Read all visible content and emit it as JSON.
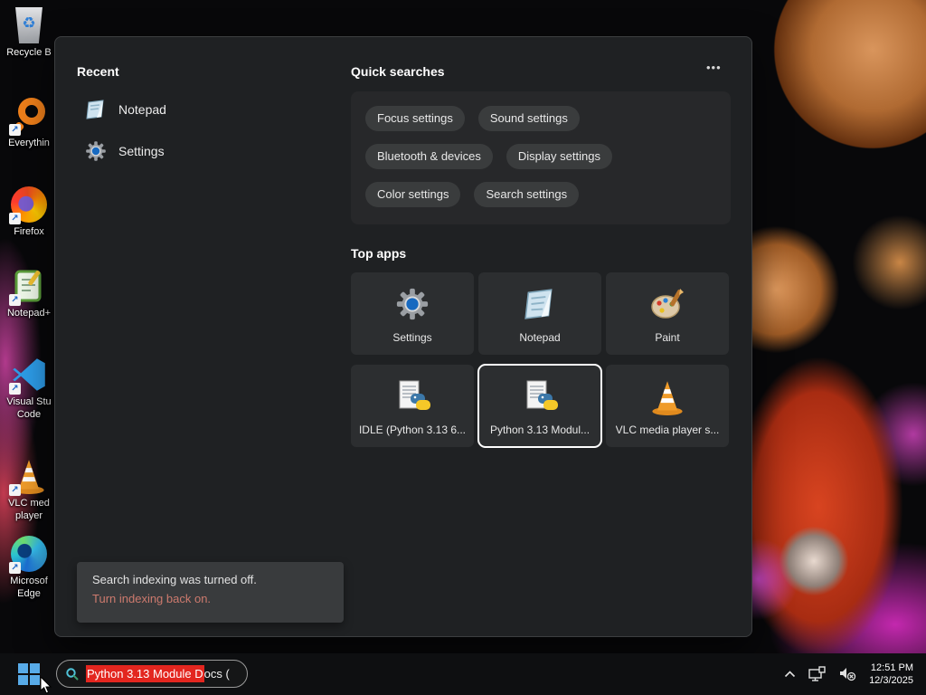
{
  "desktop": {
    "icons": [
      {
        "label": "Recycle B"
      },
      {
        "label": "Everythin"
      },
      {
        "label": "Firefox"
      },
      {
        "label": "Notepad+"
      },
      {
        "label": "Visual Stu\nCode"
      },
      {
        "label": "VLC med\nplayer"
      },
      {
        "label": "Microsof\nEdge"
      }
    ]
  },
  "search_panel": {
    "recent": {
      "title": "Recent",
      "items": [
        {
          "label": "Notepad"
        },
        {
          "label": "Settings"
        }
      ]
    },
    "quick_searches": {
      "title": "Quick searches",
      "more_label": "•••",
      "pills": [
        "Focus settings",
        "Sound settings",
        "Bluetooth & devices",
        "Display settings",
        "Color settings",
        "Search settings"
      ]
    },
    "top_apps": {
      "title": "Top apps",
      "tiles": [
        {
          "label": "Settings"
        },
        {
          "label": "Notepad"
        },
        {
          "label": "Paint"
        },
        {
          "label": "IDLE (Python 3.13 6..."
        },
        {
          "label": "Python 3.13 Modul..."
        },
        {
          "label": "VLC media player s..."
        }
      ]
    },
    "notification": {
      "message": "Search indexing was turned off.",
      "link": "Turn indexing back on."
    }
  },
  "taskbar": {
    "search": {
      "highlighted_text": "Python 3.13 Module D",
      "rest_text": "ocs ("
    },
    "clock": {
      "time": "12:51 PM",
      "date": "12/3/2025"
    }
  },
  "colors": {
    "selection_red": "#e3261f",
    "notification_link": "#cd7a6e",
    "panel_bg": "#1f2123",
    "pill_bg": "#3a3c3d",
    "tile_bg": "#2c2e30",
    "start_blue": "#58abe8"
  }
}
